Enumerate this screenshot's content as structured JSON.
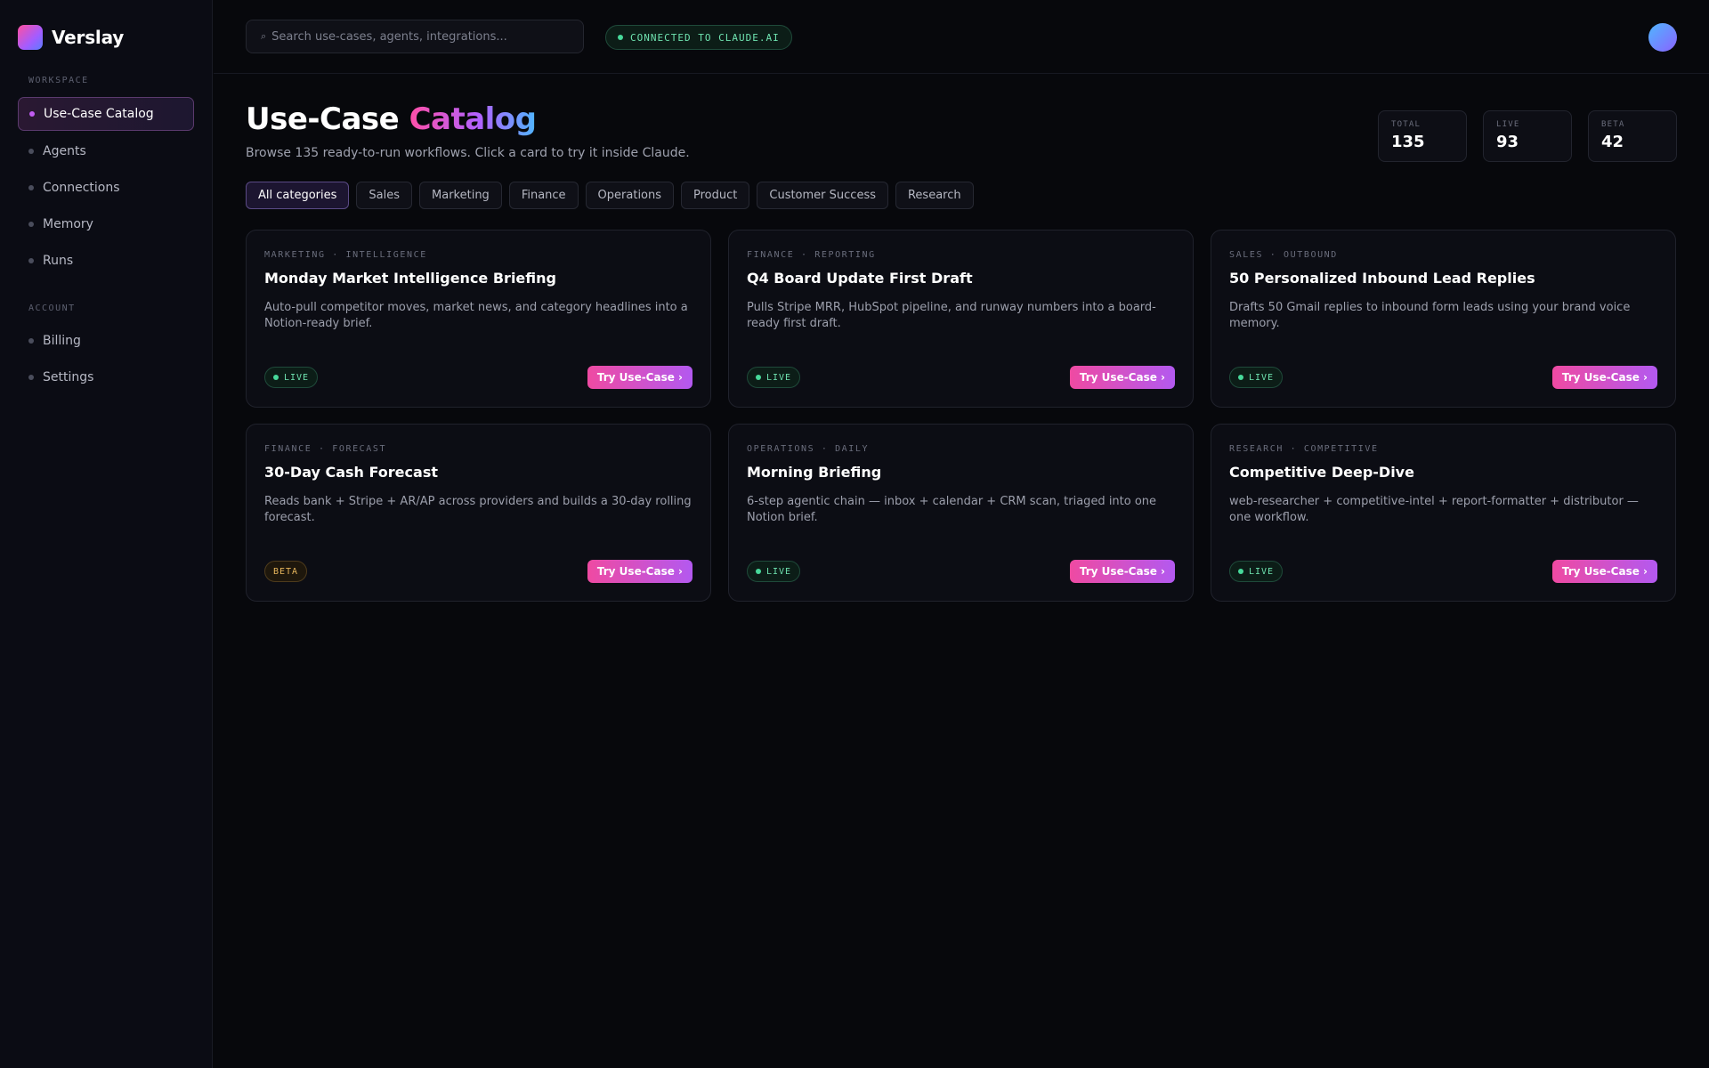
{
  "brand": {
    "name": "Verslay"
  },
  "sidebar": {
    "sections": [
      {
        "label": "WORKSPACE",
        "items": [
          {
            "label": "Use-Case Catalog",
            "active": true
          },
          {
            "label": "Agents"
          },
          {
            "label": "Connections"
          },
          {
            "label": "Memory"
          },
          {
            "label": "Runs"
          }
        ]
      },
      {
        "label": "ACCOUNT",
        "items": [
          {
            "label": "Billing"
          },
          {
            "label": "Settings"
          }
        ]
      }
    ]
  },
  "header": {
    "search_placeholder": "Search use-cases, agents, integrations...",
    "connection_status": "CONNECTED TO CLAUDE.AI"
  },
  "page": {
    "title_main": "Use-Case",
    "title_accent": "Catalog",
    "subtitle": "Browse 135 ready-to-run workflows. Click a card to try it inside Claude."
  },
  "stats": [
    {
      "label": "TOTAL",
      "value": "135"
    },
    {
      "label": "LIVE",
      "value": "93"
    },
    {
      "label": "BETA",
      "value": "42"
    }
  ],
  "filters": [
    {
      "label": "All categories",
      "active": true
    },
    {
      "label": "Sales"
    },
    {
      "label": "Marketing"
    },
    {
      "label": "Finance"
    },
    {
      "label": "Operations"
    },
    {
      "label": "Product"
    },
    {
      "label": "Customer Success"
    },
    {
      "label": "Research"
    }
  ],
  "cards": [
    {
      "category": "MARKETING · INTELLIGENCE",
      "title": "Monday Market Intelligence Briefing",
      "description": "Auto-pull competitor moves, market news, and category headlines into a Notion-ready brief.",
      "status": "LIVE",
      "button": "Try Use-Case ›"
    },
    {
      "category": "FINANCE · REPORTING",
      "title": "Q4 Board Update First Draft",
      "description": "Pulls Stripe MRR, HubSpot pipeline, and runway numbers into a board-ready first draft.",
      "status": "LIVE",
      "button": "Try Use-Case ›"
    },
    {
      "category": "SALES · OUTBOUND",
      "title": "50 Personalized Inbound Lead Replies",
      "description": "Drafts 50 Gmail replies to inbound form leads using your brand voice memory.",
      "status": "LIVE",
      "button": "Try Use-Case ›"
    },
    {
      "category": "FINANCE · FORECAST",
      "title": "30-Day Cash Forecast",
      "description": "Reads bank + Stripe + AR/AP across providers and builds a 30-day rolling forecast.",
      "status": "BETA",
      "button": "Try Use-Case ›"
    },
    {
      "category": "OPERATIONS · DAILY",
      "title": "Morning Briefing",
      "description": "6-step agentic chain — inbox + calendar + CRM scan, triaged into one Notion brief.",
      "status": "LIVE",
      "button": "Try Use-Case ›"
    },
    {
      "category": "RESEARCH · COMPETITIVE",
      "title": "Competitive Deep-Dive",
      "description": "web-researcher + competitive-intel + report-formatter + distributor — one workflow.",
      "status": "LIVE",
      "button": "Try Use-Case ›"
    }
  ]
}
